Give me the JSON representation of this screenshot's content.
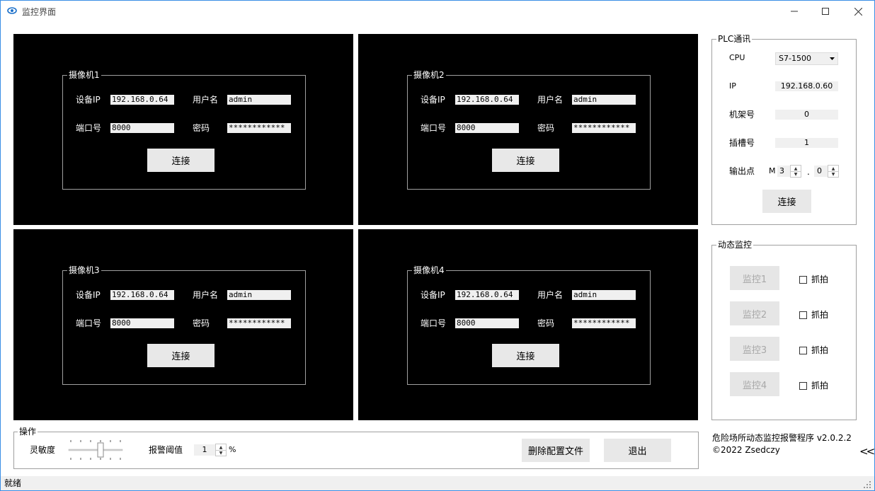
{
  "window": {
    "title": "监控界面",
    "minimize_icon": "minimize-icon",
    "maximize_icon": "maximize-icon",
    "close_icon": "close-icon"
  },
  "cameras": [
    {
      "title": "摄像机1",
      "ip_label": "设备IP",
      "ip": "192.168.0.64",
      "user_label": "用户名",
      "user": "admin",
      "port_label": "端口号",
      "port": "8000",
      "pwd_label": "密码",
      "pwd": "************",
      "connect": "连接"
    },
    {
      "title": "摄像机2",
      "ip_label": "设备IP",
      "ip": "192.168.0.64",
      "user_label": "用户名",
      "user": "admin",
      "port_label": "端口号",
      "port": "8000",
      "pwd_label": "密码",
      "pwd": "************",
      "connect": "连接"
    },
    {
      "title": "摄像机3",
      "ip_label": "设备IP",
      "ip": "192.168.0.64",
      "user_label": "用户名",
      "user": "admin",
      "port_label": "端口号",
      "port": "8000",
      "pwd_label": "密码",
      "pwd": "************",
      "connect": "连接"
    },
    {
      "title": "摄像机4",
      "ip_label": "设备IP",
      "ip": "192.168.0.64",
      "user_label": "用户名",
      "user": "admin",
      "port_label": "端口号",
      "port": "8000",
      "pwd_label": "密码",
      "pwd": "************",
      "connect": "连接"
    }
  ],
  "plc": {
    "title": "PLC通讯",
    "cpu_label": "CPU",
    "cpu_value": "S7-1500",
    "ip_label": "IP",
    "ip_value": "192.168.0.60",
    "rack_label": "机架号",
    "rack_value": "0",
    "slot_label": "插槽号",
    "slot_value": "1",
    "output_label": "输出点",
    "output_prefix": "M",
    "output_byte": "3",
    "output_dot": ".",
    "output_bit": "0",
    "connect": "连接"
  },
  "monitor": {
    "title": "动态监控",
    "items": [
      {
        "button": "监控1",
        "capture": "抓拍"
      },
      {
        "button": "监控2",
        "capture": "抓拍"
      },
      {
        "button": "监控3",
        "capture": "抓拍"
      },
      {
        "button": "监控4",
        "capture": "抓拍"
      }
    ]
  },
  "operation": {
    "title": "操作",
    "sensitivity_label": "灵敏度",
    "sensitivity_level": 0.6,
    "threshold_label": "报警阈值",
    "threshold_value": "1",
    "threshold_unit": "%",
    "delete_config": "删除配置文件",
    "exit": "退出"
  },
  "about": {
    "name": "危险场所动态监控报警程序 v2.0.2.2",
    "copyright": "©2022 Zsedczy",
    "collapse": "<<"
  },
  "status": {
    "text": "就绪"
  },
  "colors": {
    "accent": "#3a8ee6",
    "camera_bg": "#000000",
    "status_bg": "#f0f0f0"
  }
}
